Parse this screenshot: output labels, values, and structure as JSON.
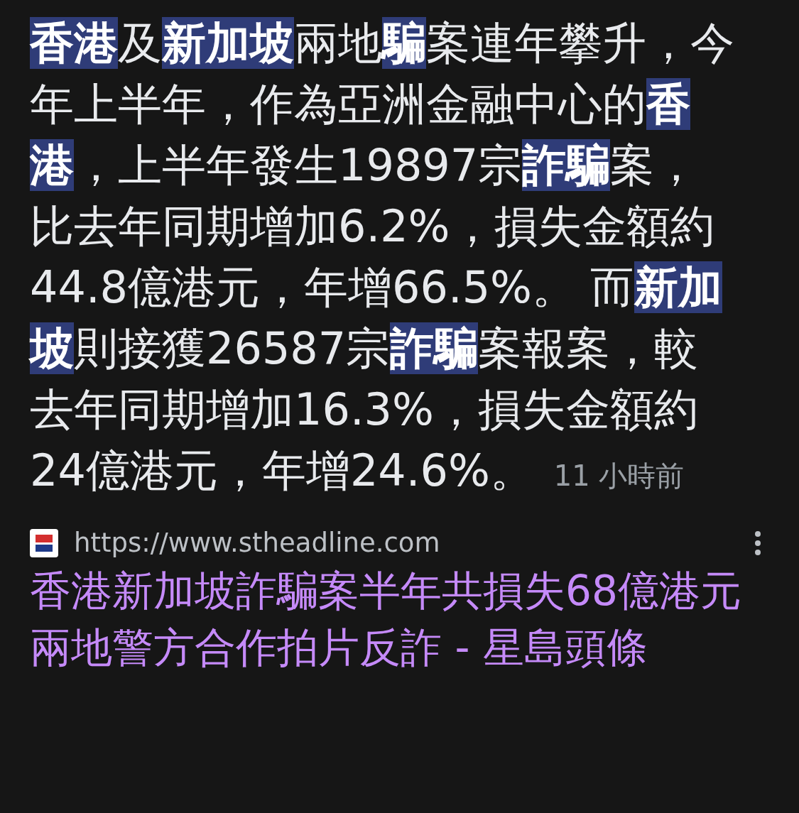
{
  "snippet": {
    "text": "**香港**及**新加坡**兩地**騙**案連年攀升，今年上半年，作為亞洲金融中心的**香港**，上半年發生19897宗**詐騙**案，比去年同期增加6.2%，損失金額約44.8億港元，年增66.5%。 而**新加坡**則接獲26587宗**詐騙**案報案，較去年同期增加16.3%，損失金額約24億港元，年增24.6%。",
    "time": "11 小時前"
  },
  "result": {
    "url": "https://www.stheadline.com",
    "title": "香港新加坡詐騙案半年共損失68億港元兩地警方合作拍片反詐 - 星島頭條"
  }
}
